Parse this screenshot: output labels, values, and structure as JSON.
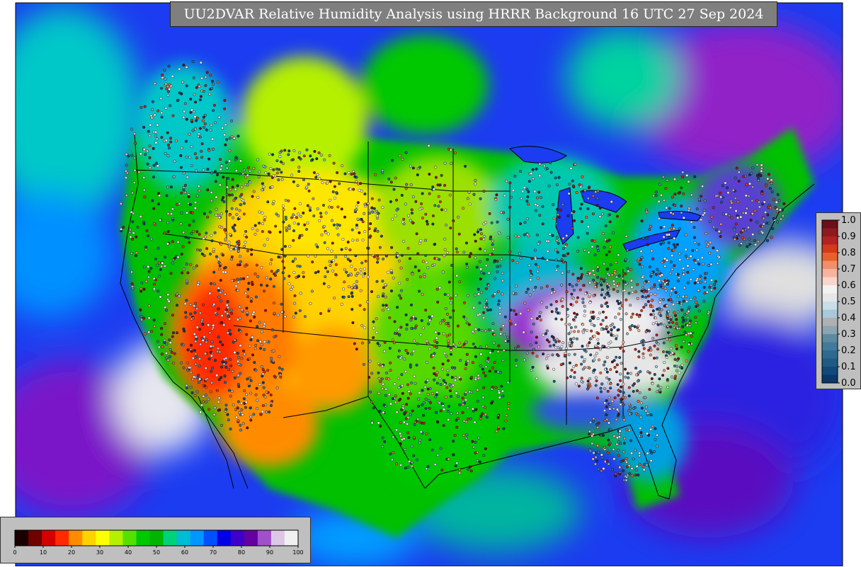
{
  "title": "UU2DVAR Relative Humidity Analysis using HRRR Background 16 UTC 27 Sep 2024",
  "rh_colorbar": {
    "ticks": [
      "0",
      "10",
      "20",
      "30",
      "40",
      "50",
      "60",
      "70",
      "80",
      "90",
      "100"
    ],
    "colors": [
      "#1a0000",
      "#6e0000",
      "#d40000",
      "#ff2a00",
      "#ff8c00",
      "#ffd200",
      "#ffff00",
      "#b4f000",
      "#55e000",
      "#00c800",
      "#00b400",
      "#00d27a",
      "#00bcd4",
      "#0096ff",
      "#0050ff",
      "#0000e6",
      "#3c00c8",
      "#6400a0",
      "#a050c8",
      "#dcc8e6",
      "#f0f0f0"
    ]
  },
  "increment_colorbar": {
    "ticks": [
      "1.0",
      "0.9",
      "0.8",
      "0.7",
      "0.6",
      "0.5",
      "0.4",
      "0.3",
      "0.2",
      "0.1",
      "0.0"
    ],
    "colors": [
      "#6b0f1a",
      "#8e1b1b",
      "#b22222",
      "#d43a1a",
      "#e8612a",
      "#f0906a",
      "#f5b3a0",
      "#f8d6cc",
      "#f2f2f2",
      "#e6e6e6",
      "#c9dde9",
      "#a8c8dc",
      "#b0b0b0",
      "#8aa6b2",
      "#5e8aa0",
      "#427a9c",
      "#2e6a90",
      "#1e5a84",
      "#10497a",
      "#0a386b"
    ]
  },
  "colors": {
    "ocean_deep": "#1e3cff",
    "ocean_mid": "#00a0ff",
    "dry_core": "#ff2a00",
    "moist_se": "#f0f0f0",
    "green_plains": "#00c800",
    "title_bg": "#7f7f7f",
    "panel_bg": "#bfbfbf"
  }
}
